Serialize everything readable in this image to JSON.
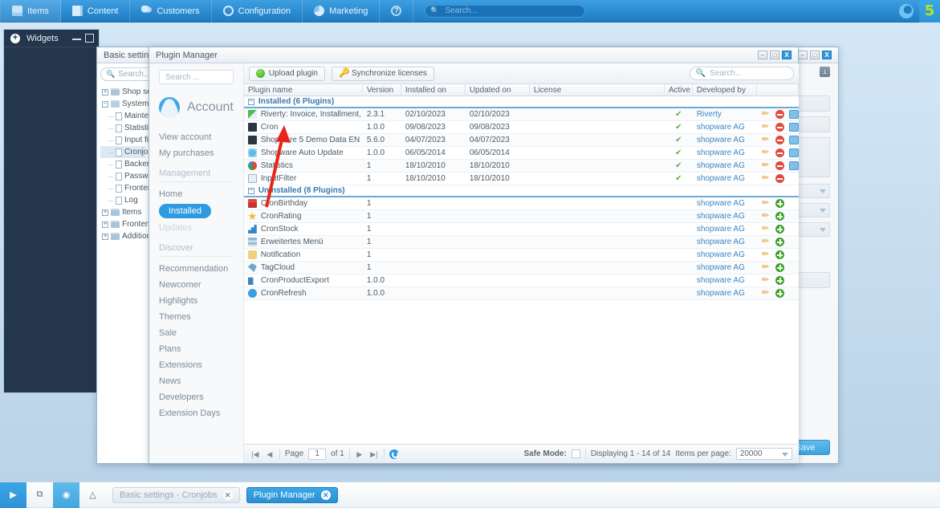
{
  "topbar": {
    "menu": [
      {
        "label": "Items",
        "icon": "box-icon"
      },
      {
        "label": "Content",
        "icon": "document-icon"
      },
      {
        "label": "Customers",
        "icon": "people-icon"
      },
      {
        "label": "Configuration",
        "icon": "gear-icon"
      },
      {
        "label": "Marketing",
        "icon": "pie-chart-icon"
      }
    ],
    "help_label": "?",
    "search_placeholder": "Search...",
    "search_value": "",
    "brand_number": "5",
    "accent": "#2e93d6"
  },
  "widgets_panel": {
    "title": "Widgets"
  },
  "settings_window": {
    "title": "Basic settings - ",
    "search_placeholder": "Search...",
    "save_label": "Save",
    "tree": [
      {
        "label": "Shop settings",
        "type": "folder",
        "depth": 0,
        "selected": false
      },
      {
        "label": "System",
        "type": "folder-open",
        "depth": 0,
        "selected": false
      },
      {
        "label": "Maintenance",
        "type": "file",
        "depth": 1,
        "selected": false
      },
      {
        "label": "Statistics",
        "type": "file",
        "depth": 1,
        "selected": false
      },
      {
        "label": "Input filter",
        "type": "file",
        "depth": 1,
        "selected": false
      },
      {
        "label": "Cronjobs",
        "type": "file",
        "depth": 1,
        "selected": true
      },
      {
        "label": "Backend",
        "type": "file",
        "depth": 1,
        "selected": false
      },
      {
        "label": "Passwords",
        "type": "file",
        "depth": 1,
        "selected": false
      },
      {
        "label": "Frontend o",
        "type": "file",
        "depth": 1,
        "selected": false
      },
      {
        "label": "Log",
        "type": "file",
        "depth": 1,
        "selected": false
      },
      {
        "label": "Items",
        "type": "folder",
        "depth": 0,
        "selected": false
      },
      {
        "label": "Frontend",
        "type": "folder",
        "depth": 0,
        "selected": false
      },
      {
        "label": "Additional set",
        "type": "folder",
        "depth": 0,
        "selected": false
      }
    ]
  },
  "plugin_manager": {
    "title": "Plugin Manager",
    "sidebar": {
      "search_placeholder": "Search ...",
      "account_label": "Account",
      "links": [
        "View account",
        "My purchases"
      ],
      "management_label": "Management",
      "management_items": [
        {
          "label": "Home",
          "state": "normal"
        },
        {
          "label": "Installed",
          "state": "active"
        },
        {
          "label": "Updates",
          "state": "disabled"
        }
      ],
      "discover_label": "Discover",
      "discover_items": [
        "Recommendation",
        "Newcomer",
        "Highlights",
        "Themes",
        "Sale",
        "Plans",
        "Extensions",
        "News",
        "Developers",
        "Extension Days"
      ]
    },
    "toolbar": {
      "upload_label": "Upload plugin",
      "sync_label": "Synchronize licenses",
      "search_placeholder": "Search..."
    },
    "columns": [
      "Plugin name",
      "Version",
      "Installed on",
      "Updated on",
      "License",
      "Active",
      "Developed by",
      ""
    ],
    "groups": [
      {
        "label": "Installed (6 Plugins)",
        "rows": [
          {
            "name": "Riverty: Invoice, Installment, Direct ...",
            "icon": "riverty-icon",
            "version": "2.3.1",
            "installed": "02/10/2023",
            "updated": "02/10/2023",
            "license": "",
            "active": "✔",
            "developer": "Riverty",
            "tools": [
              "edit",
              "uninstall",
              "reinstall"
            ]
          },
          {
            "name": "Cron",
            "icon": "terminal-icon",
            "version": "1.0.0",
            "installed": "09/08/2023",
            "updated": "09/08/2023",
            "license": "",
            "active": "✔",
            "developer": "shopware AG",
            "tools": [
              "edit",
              "uninstall",
              "reinstall"
            ]
          },
          {
            "name": "Shopware 5 Demo Data EN",
            "icon": "demo-icon",
            "version": "5.6.0",
            "installed": "04/07/2023",
            "updated": "04/07/2023",
            "license": "",
            "active": "✔",
            "developer": "shopware AG",
            "tools": [
              "edit",
              "uninstall",
              "reinstall"
            ]
          },
          {
            "name": "Shopware Auto Update",
            "icon": "update-icon",
            "version": "1.0.0",
            "installed": "06/05/2014",
            "updated": "06/05/2014",
            "license": "",
            "active": "✔",
            "developer": "shopware AG",
            "tools": [
              "edit",
              "uninstall",
              "reinstall"
            ]
          },
          {
            "name": "Statistics",
            "icon": "statistics-icon",
            "version": "1",
            "installed": "18/10/2010",
            "updated": "18/10/2010",
            "license": "",
            "active": "✔",
            "developer": "shopware AG",
            "tools": [
              "edit",
              "uninstall",
              "reinstall"
            ]
          },
          {
            "name": "InputFilter",
            "icon": "filter-icon",
            "version": "1",
            "installed": "18/10/2010",
            "updated": "18/10/2010",
            "license": "",
            "active": "✔",
            "developer": "shopware AG",
            "tools": [
              "edit",
              "uninstall"
            ]
          }
        ]
      },
      {
        "label": "Uninstalled (8 Plugins)",
        "rows": [
          {
            "name": "CronBirthday",
            "icon": "gift-icon",
            "version": "1",
            "installed": "",
            "updated": "",
            "license": "",
            "active": "",
            "developer": "shopware AG",
            "tools": [
              "edit",
              "install"
            ]
          },
          {
            "name": "CronRating",
            "icon": "star-icon",
            "version": "1",
            "installed": "",
            "updated": "",
            "license": "",
            "active": "",
            "developer": "shopware AG",
            "tools": [
              "edit",
              "install"
            ]
          },
          {
            "name": "CronStock",
            "icon": "chart-icon",
            "version": "1",
            "installed": "",
            "updated": "",
            "license": "",
            "active": "",
            "developer": "shopware AG",
            "tools": [
              "edit",
              "install"
            ]
          },
          {
            "name": "Erweitertes Menü",
            "icon": "menu-icon",
            "version": "1",
            "installed": "",
            "updated": "",
            "license": "",
            "active": "",
            "developer": "shopware AG",
            "tools": [
              "edit",
              "install"
            ]
          },
          {
            "name": "Notification",
            "icon": "speech-icon",
            "version": "1",
            "installed": "",
            "updated": "",
            "license": "",
            "active": "",
            "developer": "shopware AG",
            "tools": [
              "edit",
              "install"
            ]
          },
          {
            "name": "TagCloud",
            "icon": "tag-icon",
            "version": "1",
            "installed": "",
            "updated": "",
            "license": "",
            "active": "",
            "developer": "shopware AG",
            "tools": [
              "edit",
              "install"
            ]
          },
          {
            "name": "CronProductExport",
            "icon": "export-icon",
            "version": "1.0.0",
            "installed": "",
            "updated": "",
            "license": "",
            "active": "",
            "developer": "shopware AG",
            "tools": [
              "edit",
              "install"
            ]
          },
          {
            "name": "CronRefresh",
            "icon": "clock-icon",
            "version": "1.0.0",
            "installed": "",
            "updated": "",
            "license": "",
            "active": "",
            "developer": "shopware AG",
            "tools": [
              "edit",
              "install"
            ]
          }
        ]
      }
    ],
    "footer": {
      "page_label": "Page",
      "page_value": "1",
      "of_label": "of 1",
      "safe_mode_label": "Safe Mode:",
      "safe_mode_checked": false,
      "displaying": "Displaying 1 - 14 of 14",
      "items_per_page_label": "Items per page:",
      "items_per_page_value": "20000"
    }
  },
  "taskbar": {
    "icons": [
      "logout-icon",
      "windows-icon",
      "dashboard-icon",
      "bell-icon"
    ],
    "tasks": [
      {
        "label": "Basic settings - Cronjobs",
        "active": false
      },
      {
        "label": "Plugin Manager",
        "active": true
      }
    ]
  }
}
